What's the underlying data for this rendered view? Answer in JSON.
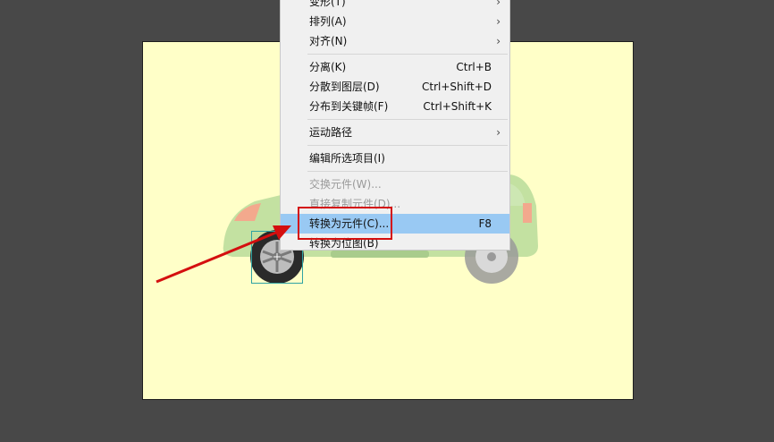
{
  "context_menu": {
    "items": [
      {
        "label": "变形(T)",
        "shortcut": "",
        "submenu": true,
        "disabled": false
      },
      {
        "label": "排列(A)",
        "shortcut": "",
        "submenu": true,
        "disabled": false
      },
      {
        "label": "对齐(N)",
        "shortcut": "",
        "submenu": true,
        "disabled": false
      },
      {
        "label": "分离(K)",
        "shortcut": "Ctrl+B",
        "submenu": false,
        "disabled": false
      },
      {
        "label": "分散到图层(D)",
        "shortcut": "Ctrl+Shift+D",
        "submenu": false,
        "disabled": false
      },
      {
        "label": "分布到关键帧(F)",
        "shortcut": "Ctrl+Shift+K",
        "submenu": false,
        "disabled": false
      },
      {
        "label": "运动路径",
        "shortcut": "",
        "submenu": true,
        "disabled": false
      },
      {
        "label": "编辑所选项目(I)",
        "shortcut": "",
        "submenu": false,
        "disabled": false
      },
      {
        "label": "交换元件(W)...",
        "shortcut": "",
        "submenu": false,
        "disabled": true
      },
      {
        "label": "直接复制元件(D)...",
        "shortcut": "",
        "submenu": false,
        "disabled": true
      },
      {
        "label": "转换为元件(C)...",
        "shortcut": "F8",
        "submenu": false,
        "disabled": false,
        "highlighted": true
      },
      {
        "label": "转换为位图(B)",
        "shortcut": "",
        "submenu": false,
        "disabled": false
      }
    ],
    "submenu_arrow": "›"
  },
  "colors": {
    "workspace": "#484848",
    "stage": "#ffffc8",
    "menu_bg": "#f0f0f0",
    "highlight": "#99c9f3",
    "annotation": "#d40f0f",
    "car_body": "#b8dc9a"
  },
  "icons": {
    "submenu": "chevron-right-icon",
    "annotation_arrow": "red-arrow-icon"
  }
}
